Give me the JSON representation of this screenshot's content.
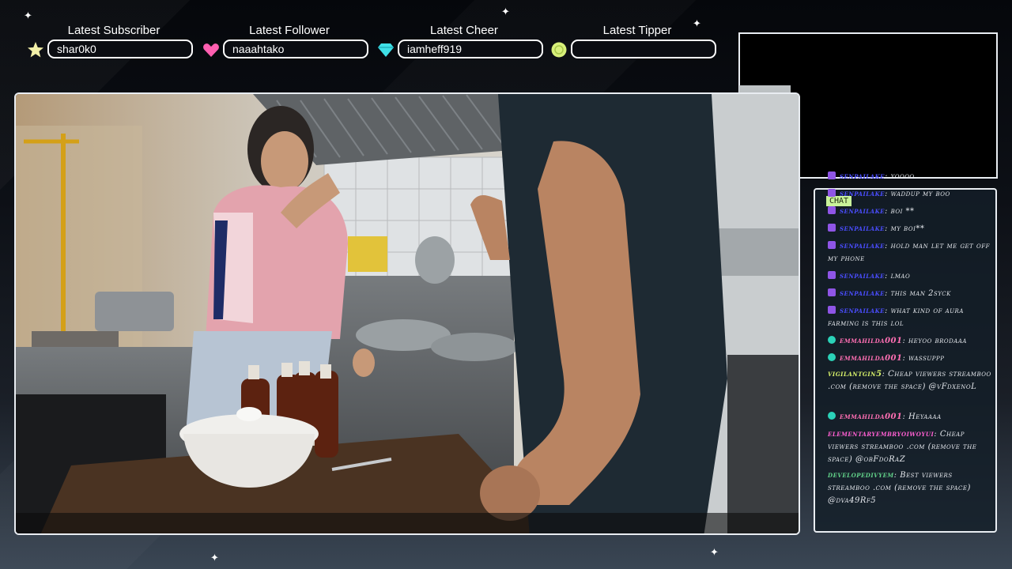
{
  "alerts": {
    "subscriber": {
      "label": "Latest Subscriber",
      "value": "shar0k0"
    },
    "follower": {
      "label": "Latest Follower",
      "value": "naaahtako"
    },
    "cheer": {
      "label": "Latest Cheer",
      "value": "iamheff919"
    },
    "tipper": {
      "label": "Latest Tipper",
      "value": ""
    }
  },
  "chat": {
    "tab_label": "CHAT",
    "messages": [
      {
        "user": "senpailake",
        "text": "yoooo",
        "user_color": "#4a4dff"
      },
      {
        "user": "senpailake",
        "text": "waddup my boo",
        "user_color": "#4a4dff"
      },
      {
        "user": "senpailake",
        "text": "boi **",
        "user_color": "#4a4dff"
      },
      {
        "user": "senpailake",
        "text": "my boi**",
        "user_color": "#4a4dff"
      },
      {
        "user": "senpailake",
        "text": "hold man let me get off my phone",
        "user_color": "#4a4dff"
      },
      {
        "user": "senpailake",
        "text": "lmao",
        "user_color": "#4a4dff"
      },
      {
        "user": "senpailake",
        "text": "this man 2syck",
        "user_color": "#4a4dff"
      },
      {
        "user": "senpailake",
        "text": "what kind of aura farming is this lol",
        "user_color": "#4a4dff"
      },
      {
        "user": "emmahilda001",
        "text": "heyoo brodaaa",
        "user_color": "#ff6fb3"
      },
      {
        "user": "emmahilda001",
        "text": "wassuppp",
        "user_color": "#ff6fb3"
      },
      {
        "user": "vigilantgin5",
        "text": "Cheap viewers streamboo .com (remove the space) @vFdxenoL",
        "user_color": "#d9f36b"
      },
      {
        "user": "emmahilda001",
        "text": "Heyaaaa",
        "user_color": "#ff6fb3"
      },
      {
        "user": "elementaryembryoiwoyui",
        "text": "Cheap viewers streamboo .com (remove the space) @obFdoRaZ",
        "user_color": "#ff5fd2"
      },
      {
        "user": "developedivyem",
        "text": "Best viewers streamboo .com (remove the space) @dva49Rf5",
        "user_color": "#62d38a"
      }
    ]
  },
  "colors": {
    "accent": "#e9edf2",
    "chat_tab": "#c9f39a",
    "sub_star": "#f3f0a8",
    "heart": "#ff5fb0",
    "diamond": "#3fe0e6",
    "coin": "#d8f07a"
  }
}
